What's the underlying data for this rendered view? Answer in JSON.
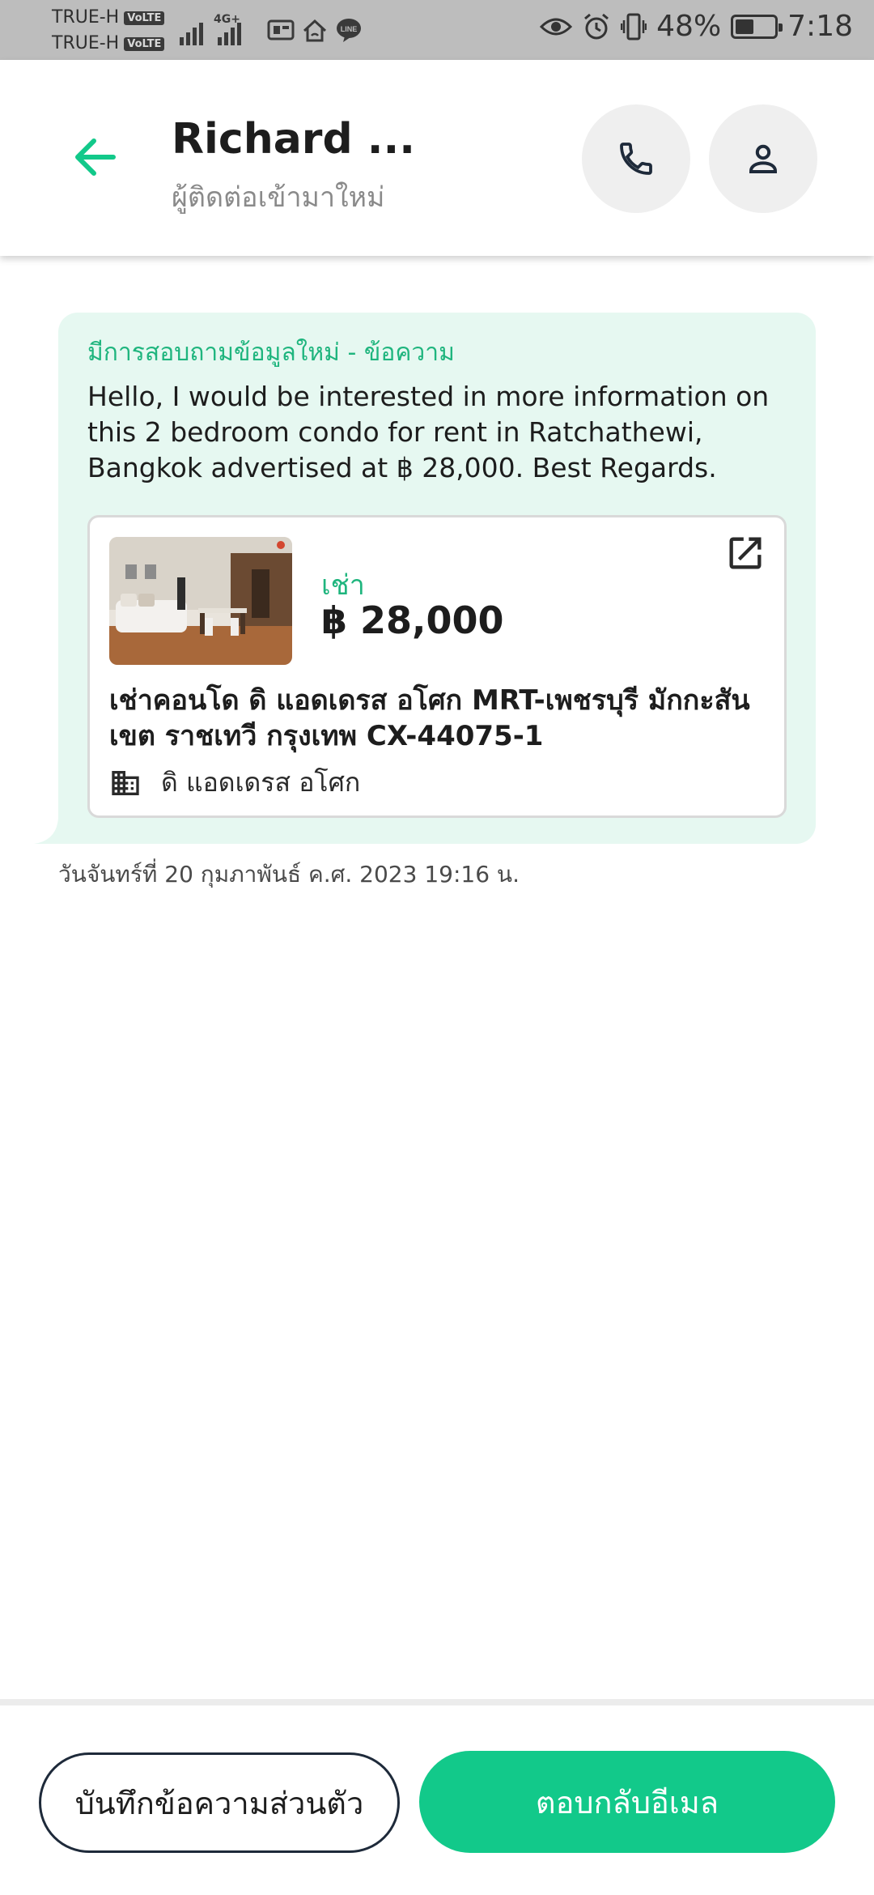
{
  "status_bar": {
    "carrier1": "TRUE-H",
    "carrier2": "TRUE-H",
    "volte_badge": "VoLTE",
    "network_label": "4G+",
    "battery_percent": "48%",
    "battery_level": 0.48,
    "time": "7:18",
    "icons": [
      "signal-icon",
      "signal-4g-icon",
      "vpn-icon",
      "home-network-icon",
      "line-app-icon",
      "eye-icon",
      "alarm-icon",
      "vibrate-icon",
      "battery-icon"
    ]
  },
  "header": {
    "title": "Richard ...",
    "subtitle": "ผู้ติดต่อเข้ามาใหม่"
  },
  "message": {
    "heading": "มีการสอบถามข้อมูลใหม่ - ข้อความ",
    "body": "Hello, I would be interested in more information on this 2 bedroom condo for rent in Ratchathewi, Bangkok advertised at ฿ 28,000. Best Regards.",
    "timestamp": "วันจันทร์ที่ 20 กุมภาพันธ์ ค.ศ. 2023 19:16 น."
  },
  "listing": {
    "type_label": "เช่า",
    "price": "฿ 28,000",
    "title": "เช่าคอนโด  ดิ แอดเดรส อโศก MRT-เพชรบุรี มักกะสัน เขต ราชเทวี กรุงเทพ CX-44075-1",
    "project_name": "ดิ แอดเดรส อโศก"
  },
  "actions": {
    "note_label": "บันทึกข้อความส่วนตัว",
    "reply_label": "ตอบกลับอีเมล"
  },
  "colors": {
    "accent": "#12c98a",
    "accent_text": "#1fb57e",
    "bubble_bg": "#e6f8f1",
    "status_bar_bg": "#bdbdbd"
  }
}
